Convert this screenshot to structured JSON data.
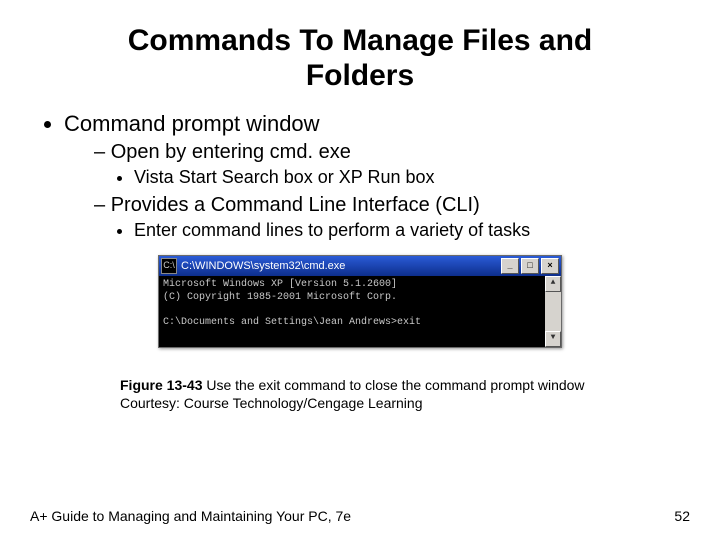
{
  "title": "Commands To Manage Files and Folders",
  "b1": "Command prompt window",
  "b1a": "Open by entering cmd. exe",
  "b1a1": "Vista Start Search box or XP Run box",
  "b1b": "Provides a Command Line Interface (CLI)",
  "b1b1": "Enter command lines to perform a variety of tasks",
  "cmd": {
    "title": "C:\\WINDOWS\\system32\\cmd.exe",
    "line1": "Microsoft Windows XP [Version 5.1.2600]",
    "line2": "(C) Copyright 1985-2001 Microsoft Corp.",
    "blank": "",
    "line3": "C:\\Documents and Settings\\Jean Andrews>exit",
    "min": "_",
    "max": "□",
    "close": "×",
    "up": "▲",
    "dn": "▼",
    "iconglyph": "C:\\"
  },
  "figno": "Figure 13-43",
  "figtxt": " Use the exit command to close the command prompt window",
  "credit": "Courtesy: Course Technology/Cengage Learning",
  "footerL": "A+ Guide to Managing and Maintaining Your PC, 7e",
  "footerR": "52"
}
